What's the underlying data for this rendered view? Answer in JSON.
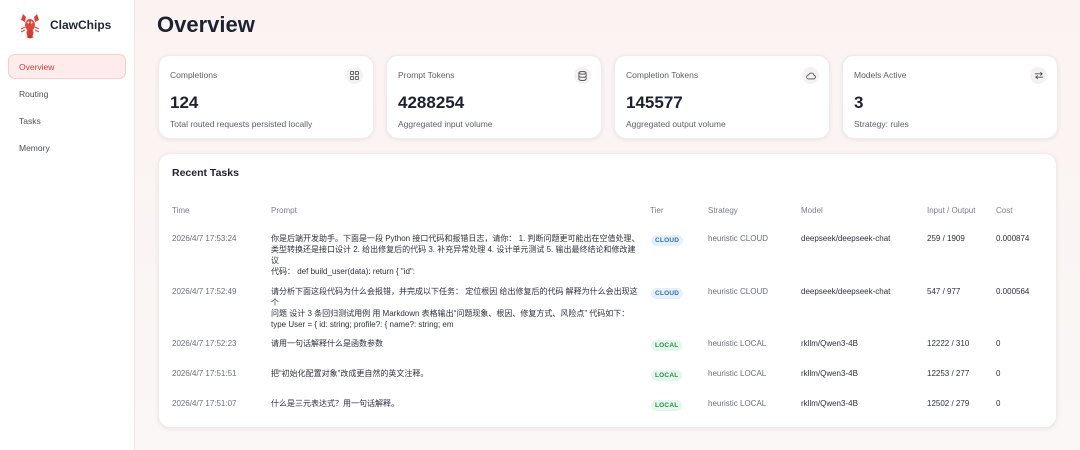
{
  "app": {
    "name": "ClawChips"
  },
  "nav": [
    {
      "label": "Overview",
      "active": true
    },
    {
      "label": "Routing",
      "active": false
    },
    {
      "label": "Tasks",
      "active": false
    },
    {
      "label": "Memory",
      "active": false
    }
  ],
  "page": {
    "title": "Overview"
  },
  "stats": [
    {
      "label": "Completions",
      "value": "124",
      "sub": "Total routed requests persisted locally",
      "icon": "grid-icon"
    },
    {
      "label": "Prompt Tokens",
      "value": "4288254",
      "sub": "Aggregated input volume",
      "icon": "database-icon"
    },
    {
      "label": "Completion Tokens",
      "value": "145577",
      "sub": "Aggregated output volume",
      "icon": "cloud-icon"
    },
    {
      "label": "Models Active",
      "value": "3",
      "sub": "Strategy: rules",
      "icon": "swap-icon"
    }
  ],
  "tasks": {
    "title": "Recent Tasks",
    "columns": [
      "Time",
      "Prompt",
      "Tier",
      "Strategy",
      "Model",
      "Input / Output",
      "Cost"
    ],
    "rows": [
      {
        "time": "2026/4/7 17:53:24",
        "prompt": [
          "你是后端开发助手。下面是一段 Python 接口代码和报错日志，请你： 1. 判断问题更可能出在空值处理、",
          "类型转换还是接口设计 2. 给出修复后的代码 3. 补充异常处理 4. 设计单元测试 5. 输出最终结论和修改建议",
          "代码： def build_user(data): return { \"id\":"
        ],
        "tier": "CLOUD",
        "strategy": "heuristic CLOUD",
        "model": "deepseek/deepseek-chat",
        "io": "259 / 1909",
        "cost": "0.000874"
      },
      {
        "time": "2026/4/7 17:52:49",
        "prompt": [
          "请分析下面这段代码为什么会报错，并完成以下任务： 定位根因 给出修复后的代码 解释为什么会出现这个",
          "问题 设计 3 条回归测试用例 用 Markdown 表格输出“问题现象、根因、修复方式、风险点” 代码如下：",
          "type User = { id: string; profile?: { name?: string; em"
        ],
        "tier": "CLOUD",
        "strategy": "heuristic CLOUD",
        "model": "deepseek/deepseek-chat",
        "io": "547 / 977",
        "cost": "0.000564"
      },
      {
        "time": "2026/4/7 17:52:23",
        "prompt": [
          "请用一句话解释什么是函数参数"
        ],
        "tier": "LOCAL",
        "strategy": "heuristic LOCAL",
        "model": "rkllm/Qwen3-4B",
        "io": "12222 / 310",
        "cost": "0"
      },
      {
        "time": "2026/4/7 17:51:51",
        "prompt": [
          "把“初始化配置对象”改成更自然的英文注释。"
        ],
        "tier": "LOCAL",
        "strategy": "heuristic LOCAL",
        "model": "rkllm/Qwen3-4B",
        "io": "12253 / 277",
        "cost": "0"
      },
      {
        "time": "2026/4/7 17:51:07",
        "prompt": [
          "什么是三元表达式？用一句话解释。"
        ],
        "tier": "LOCAL",
        "strategy": "heuristic LOCAL",
        "model": "rkllm/Qwen3-4B",
        "io": "12502 / 279",
        "cost": "0"
      }
    ]
  },
  "colors": {
    "accent": "#c9403a",
    "cloud": "#2f6fb0",
    "local": "#2e8a4e"
  }
}
